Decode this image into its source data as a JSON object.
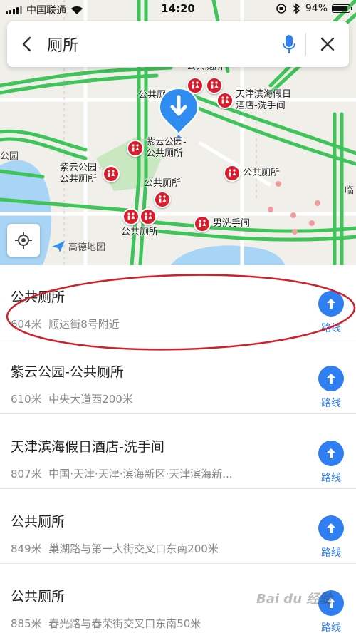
{
  "status_bar": {
    "carrier": "中国联通",
    "time": "14:20",
    "battery": "94%",
    "battery_level": 0.94
  },
  "search": {
    "query": "厕所",
    "back_icon": "chevron-left-icon",
    "mic_icon": "microphone-icon",
    "close_icon": "close-icon"
  },
  "map": {
    "pois": [
      {
        "label": "公共厕所",
        "icon": "toilet-icon"
      },
      {
        "label": "公共厕所",
        "icon": "toilet-icon"
      },
      {
        "label": "天津滨海假日\n酒店-洗手间",
        "icon": "toilet-icon"
      },
      {
        "label": "紫云公园-\n公共厕所",
        "icon": "toilet-icon"
      },
      {
        "label": "紫云公园-\n公共厕所",
        "icon": "toilet-icon"
      },
      {
        "label": "公共厕所",
        "icon": "toilet-icon"
      },
      {
        "label": "公共厕所",
        "icon": "toilet-icon"
      },
      {
        "label": "公共厕所",
        "icon": "toilet-icon"
      },
      {
        "label": "男洗手间",
        "icon": "toilet-icon"
      }
    ],
    "edge_labels": [
      "公园",
      "临"
    ],
    "logo_text": "高德地图",
    "colors": {
      "road": "#3fc45a",
      "water": "#a8d4f5",
      "park": "#c9e8c1",
      "pin": "#d81e2d",
      "marker": "#2f8cf0"
    }
  },
  "results": [
    {
      "name": "公共厕所",
      "distance": "604米",
      "address": "顺达街8号附近",
      "route_label": "路线"
    },
    {
      "name": "紫云公园-公共厕所",
      "distance": "610米",
      "address": "中央大道西200米",
      "route_label": "路线"
    },
    {
      "name": "天津滨海假日酒店-洗手间",
      "distance": "807米",
      "address": "中国·天津·天津·滨海新区·天津滨海新...",
      "route_label": "路线"
    },
    {
      "name": "公共厕所",
      "distance": "849米",
      "address": "巢湖路与第一大街交叉口东南200米",
      "route_label": "路线"
    },
    {
      "name": "公共厕所",
      "distance": "885米",
      "address": "春光路与春荣街交叉口东南50米",
      "route_label": "路线"
    }
  ],
  "accent_color": "#2f7ef2",
  "annotation_color": "#d0202a",
  "watermark": "Bai du 经验"
}
